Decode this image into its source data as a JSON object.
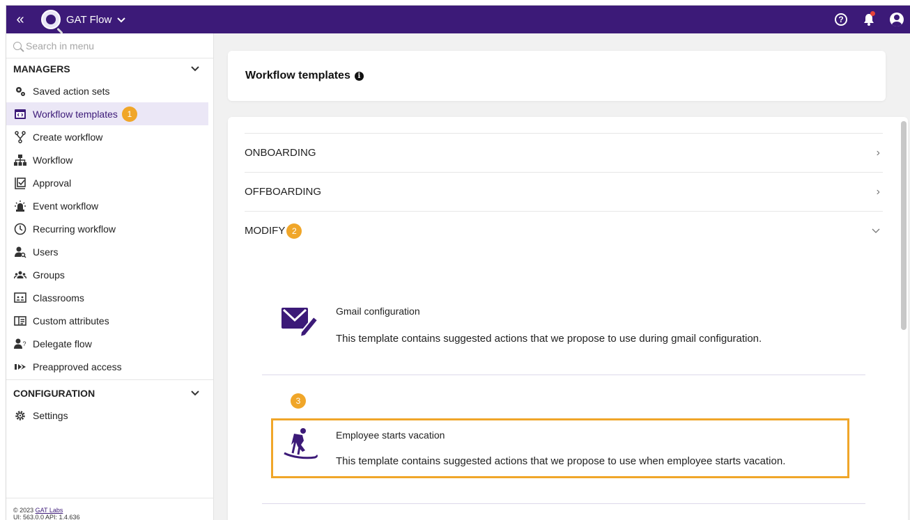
{
  "topbar": {
    "collapse_glyph": "«",
    "app_name": "GAT Flow",
    "icons": [
      "double-chevron-left-icon",
      "app-logo-icon",
      "chevron-down-icon",
      "help-icon",
      "bell-icon",
      "user-account-icon"
    ]
  },
  "sidebar": {
    "search_placeholder": "Search in menu",
    "managers": {
      "title": "MANAGERS",
      "items": [
        {
          "label": "Saved action sets",
          "icon": "gears-icon"
        },
        {
          "label": "Workflow templates",
          "icon": "template-icon",
          "active": true,
          "badge": "1"
        },
        {
          "label": "Create workflow",
          "icon": "fork-icon"
        },
        {
          "label": "Workflow",
          "icon": "sitemap-icon"
        },
        {
          "label": "Approval",
          "icon": "approval-icon"
        },
        {
          "label": "Event workflow",
          "icon": "siren-icon"
        },
        {
          "label": "Recurring workflow",
          "icon": "clock-icon"
        },
        {
          "label": "Users",
          "icon": "user-search-icon"
        },
        {
          "label": "Groups",
          "icon": "group-icon"
        },
        {
          "label": "Classrooms",
          "icon": "classroom-icon"
        },
        {
          "label": "Custom attributes",
          "icon": "attributes-icon"
        },
        {
          "label": "Delegate flow",
          "icon": "delegate-icon"
        },
        {
          "label": "Preapproved access",
          "icon": "preapproved-icon"
        }
      ]
    },
    "configuration": {
      "title": "CONFIGURATION",
      "items": [
        {
          "label": "Settings",
          "icon": "gear-icon"
        }
      ]
    },
    "footer": {
      "copyright": "© 2023",
      "company_link": "GAT Labs",
      "version": "UI: 563.0.0 API: 1.4.636"
    }
  },
  "main": {
    "page_title": "Workflow templates",
    "info_glyph": "i",
    "categories": [
      {
        "label": "ONBOARDING",
        "caret": "›"
      },
      {
        "label": "OFFBOARDING",
        "caret": "›"
      },
      {
        "label": "MODIFY",
        "caret": "⌄",
        "badge": "2",
        "expanded": true
      }
    ],
    "templates": [
      {
        "title": "Gmail configuration",
        "description": "This template contains suggested actions that we propose to use during gmail configuration.",
        "icon": "mail-edit-icon"
      },
      {
        "title": "Employee starts vacation",
        "description": "This template contains suggested actions that we propose to use when employee starts vacation.",
        "icon": "skiing-icon",
        "badge": "3",
        "highlighted": true
      }
    ]
  },
  "colors": {
    "topbar": "#3c1a78",
    "accent": "#3c1a78",
    "badge": "#f0a629",
    "active_bg": "#ebe7f6"
  }
}
